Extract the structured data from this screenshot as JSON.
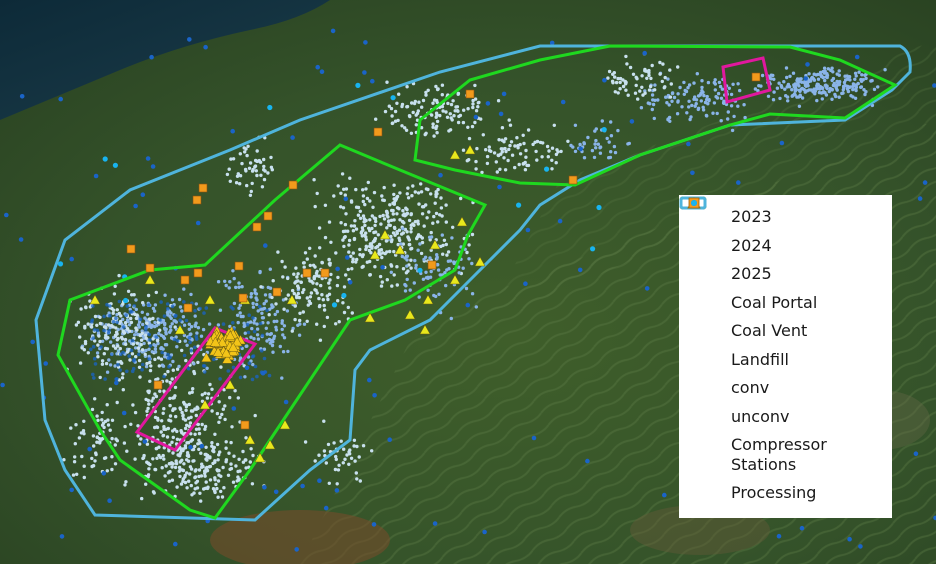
{
  "map": {
    "colors": {
      "y2023": "#e0189e",
      "y2024": "#1fd81f",
      "y2025": "#4fb4dc",
      "coal_portal": "#e8e81c",
      "coal_vent": "#f2c418",
      "landfill": "#f29a1c",
      "conv": "#c8e0ee",
      "unconv": "#8ab4e8",
      "compressor": "#1a64c8",
      "processing": "#18b4f0"
    }
  },
  "legend": {
    "items": [
      {
        "label": "2023",
        "symbol": "rect-outline",
        "color": "#e0189e"
      },
      {
        "label": "2024",
        "symbol": "rect-outline",
        "color": "#1fd81f"
      },
      {
        "label": "2025",
        "symbol": "rect-outline",
        "color": "#4fb4dc"
      },
      {
        "label": "Coal Portal",
        "symbol": "triangle",
        "color": "#e8e81c"
      },
      {
        "label": "Coal Vent",
        "symbol": "triangle",
        "color": "#f2c418"
      },
      {
        "label": "Landfill",
        "symbol": "square",
        "color": "#f29a1c"
      },
      {
        "label": "conv",
        "symbol": "dot-small",
        "color": "#c8e0ee"
      },
      {
        "label": "unconv",
        "symbol": "dot-small",
        "color": "#8ab4e8"
      },
      {
        "label": "Compressor Stations",
        "symbol": "dot",
        "color": "#1a64c8"
      },
      {
        "label": "Processing",
        "symbol": "dot",
        "color": "#18b4f0"
      }
    ]
  }
}
